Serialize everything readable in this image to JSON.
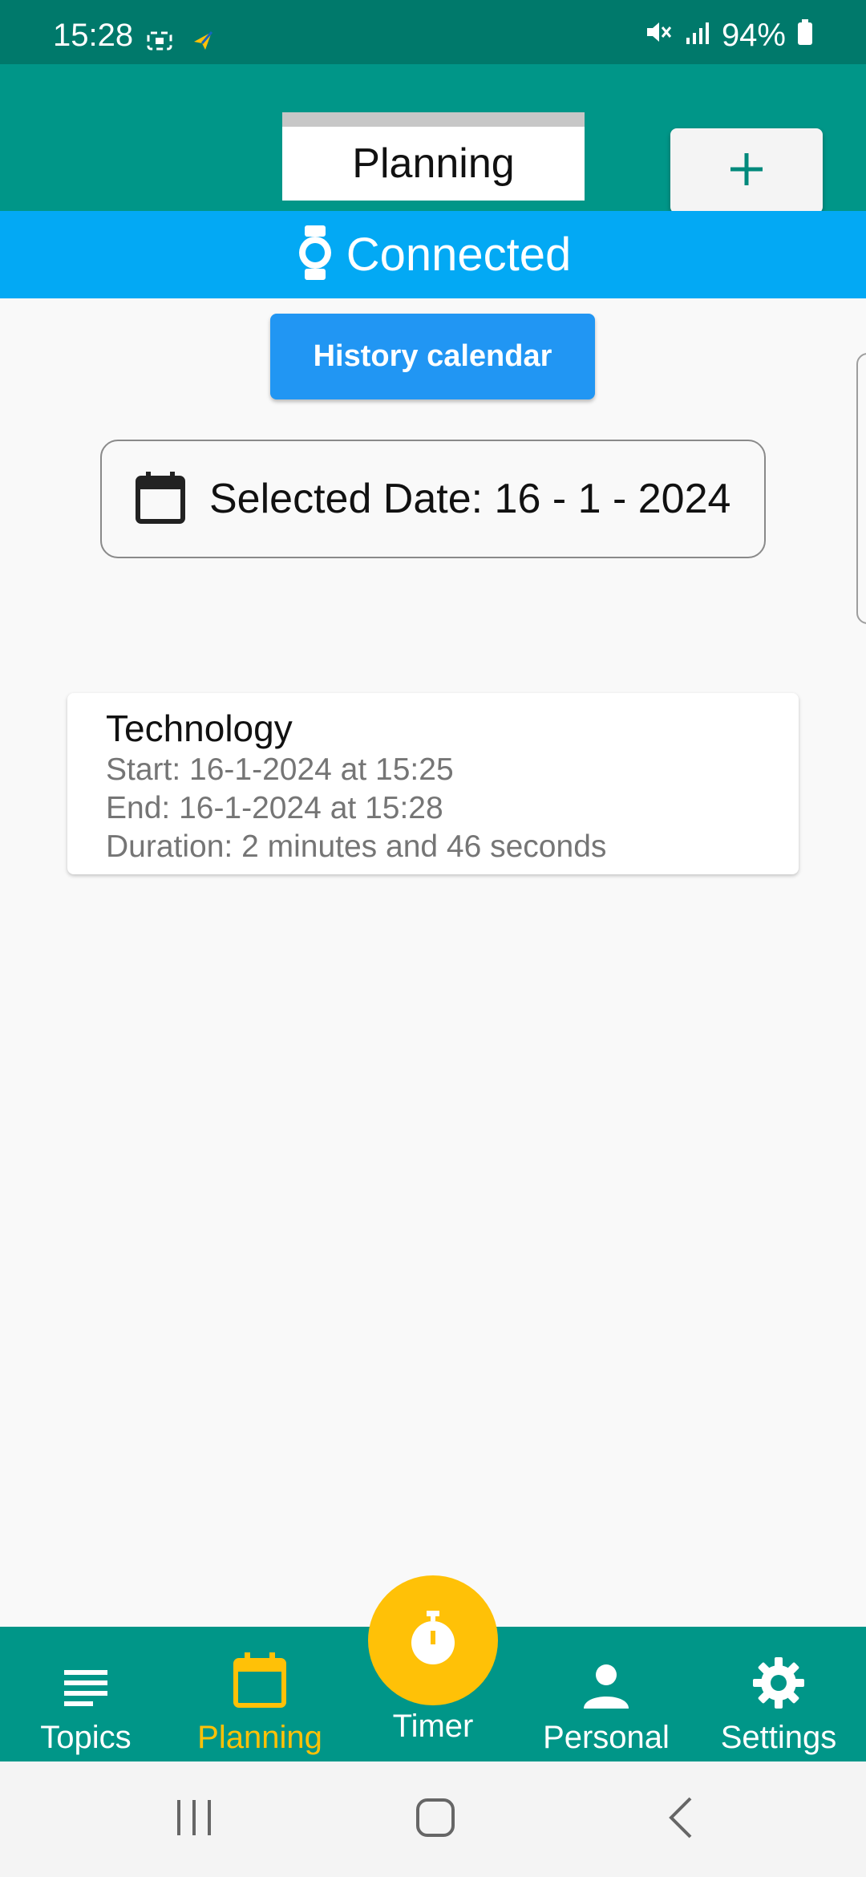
{
  "status_bar": {
    "time": "15:28",
    "battery": "94%",
    "icons": [
      "screen-record-icon",
      "app-notification-icon",
      "mute-icon",
      "signal-icon",
      "battery-icon"
    ]
  },
  "app_bar": {
    "title": "Planning",
    "add_label": "+"
  },
  "connection": {
    "status": "Connected",
    "icon": "watch-icon"
  },
  "history_button": {
    "label": "History calendar"
  },
  "date_selector": {
    "label": "Selected Date: 16 - 1 - 2024",
    "icon": "calendar-icon"
  },
  "sessions": [
    {
      "topic": "Technology",
      "start": "Start: 16-1-2024 at 15:25",
      "end": "End: 16-1-2024 at 15:28",
      "duration": "Duration: 2 minutes and 46 seconds"
    }
  ],
  "bottom_nav": {
    "items": [
      {
        "label": "Topics",
        "icon": "list-icon"
      },
      {
        "label": "Planning",
        "icon": "calendar-icon"
      },
      {
        "label": "Timer",
        "icon": "stopwatch-icon"
      },
      {
        "label": "Personal",
        "icon": "person-icon"
      },
      {
        "label": "Settings",
        "icon": "gear-icon"
      }
    ],
    "active": "Planning"
  },
  "colors": {
    "status_bar": "#00796b",
    "app_bar": "#009688",
    "banner": "#03a9f4",
    "button": "#2196f3",
    "accent": "#ffc107"
  }
}
